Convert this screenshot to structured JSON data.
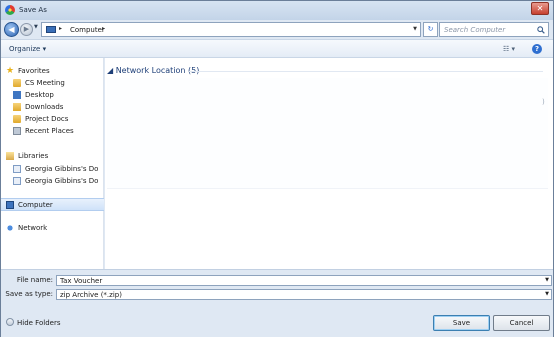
{
  "window": {
    "title": "Save As",
    "close_glyph": "✕"
  },
  "nav": {
    "back_glyph": "◀",
    "forward_glyph": "▶",
    "history_glyph": "▼",
    "address_path": "Computer",
    "address_sep": "▸",
    "address_drop_glyph": "▼",
    "refresh_glyph": "↻",
    "search_placeholder": "Search Computer"
  },
  "command_bar": {
    "organize_label": "Organize ▾",
    "views_glyph": "☷ ▾",
    "help_glyph": "?"
  },
  "sidebar": {
    "favorites": {
      "label": "Favorites",
      "items": [
        "CS Meeting",
        "Desktop",
        "Downloads",
        "Project Docs",
        "Recent Places"
      ]
    },
    "libraries": {
      "label": "Libraries",
      "items": [
        "Georgia Gibbins's Do",
        "Georgia Gibbins's Do"
      ]
    },
    "computer_label": "Computer",
    "network_label": "Network"
  },
  "content": {
    "group_header": "◢ Network Location (5)",
    "scroll_mark": ")"
  },
  "form": {
    "file_name_label": "File name:",
    "file_name_value": "Tax Voucher",
    "save_type_label": "Save as type:",
    "save_type_value": "zip Archive (*.zip)",
    "drop_glyph": "▼"
  },
  "footer": {
    "hide_folders_label": "Hide Folders",
    "save_label": "Save",
    "cancel_label": "Cancel"
  },
  "colors": {
    "accent": "#1e3f78",
    "title_bar": "#c3d4e8",
    "close": "#c6402f"
  },
  "icons": {
    "favorites": "star-icon",
    "folder": "folder-icon",
    "desktop": "desktop-icon",
    "computer": "computer-icon",
    "network": "network-icon",
    "search": "search-icon"
  }
}
